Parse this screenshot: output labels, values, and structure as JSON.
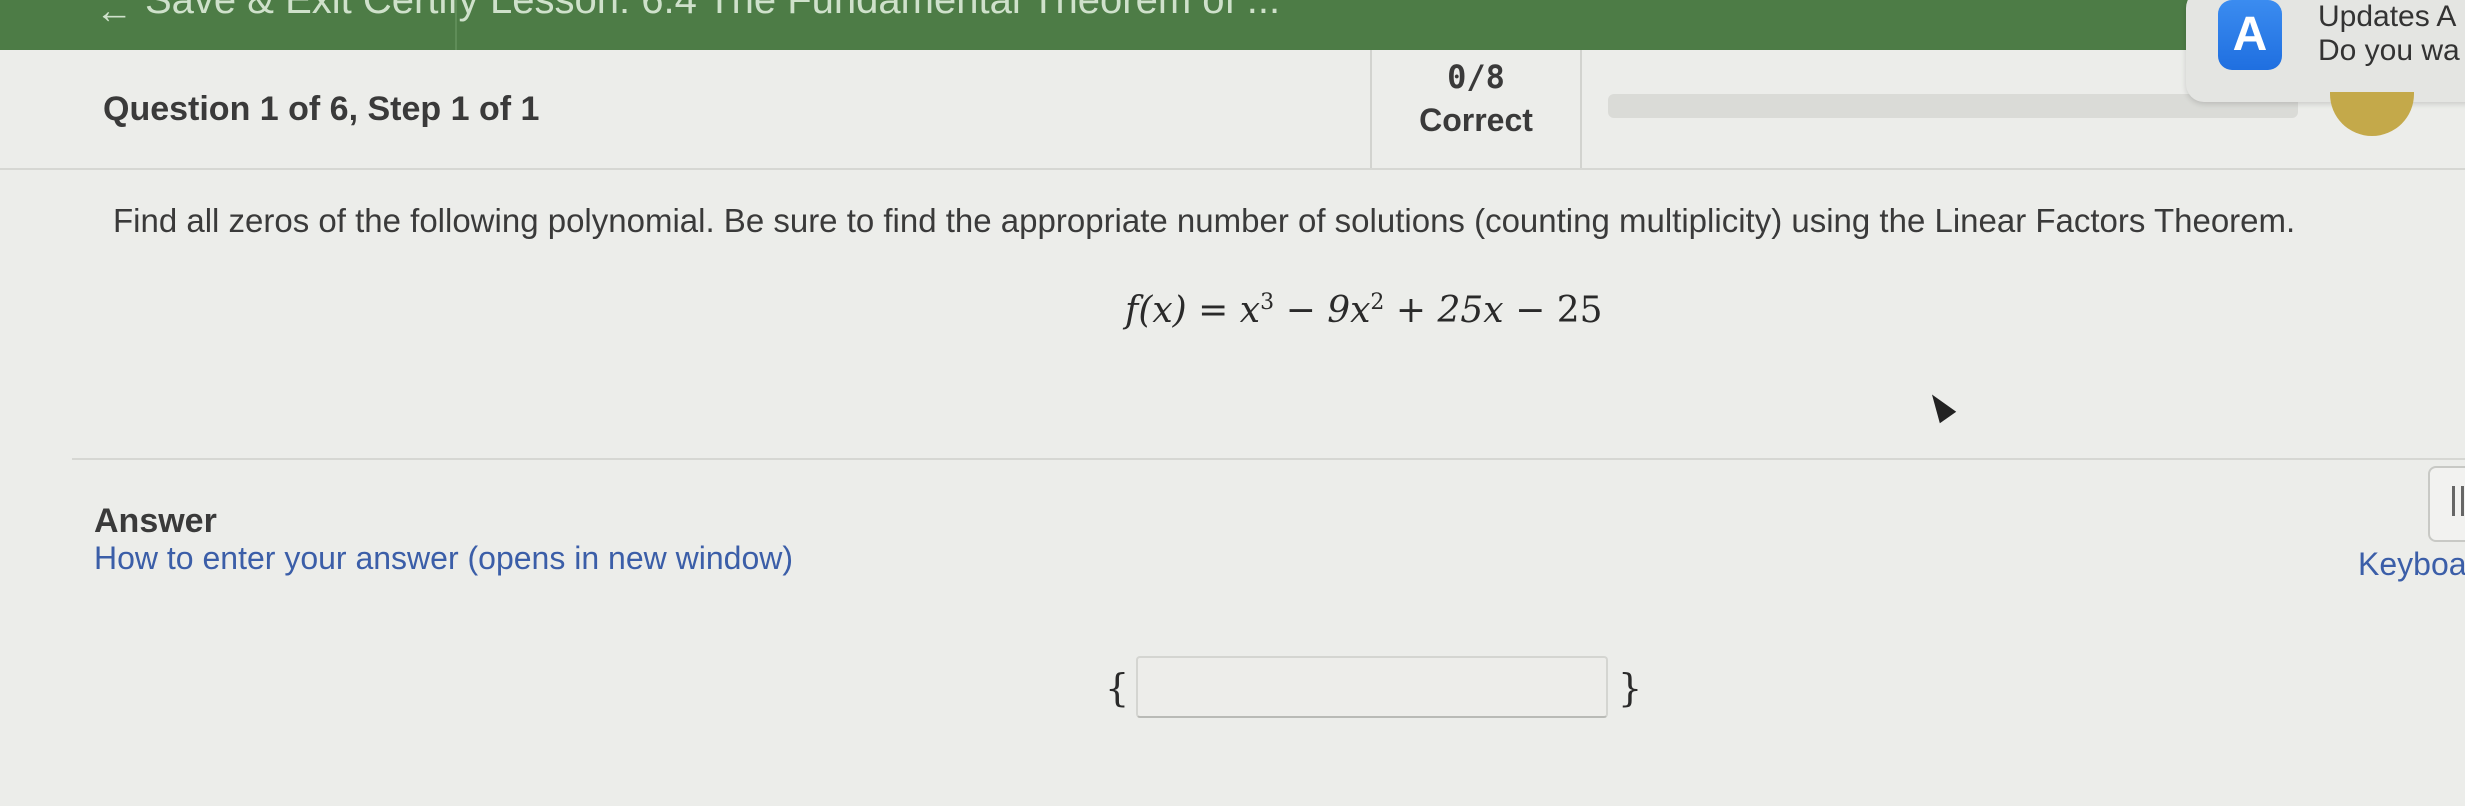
{
  "topbar": {
    "left_crumb": "Save & Exit Certify",
    "mid_crumb": "Lesson: 6.4 The Fundamental Theorem of ...",
    "accent": "#4d7c46"
  },
  "question": {
    "title": "Question 1 of 6, Step 1 of 1",
    "score": "0/8",
    "score_label": "Correct",
    "progress": 0,
    "prompt": "Find all zeros of the following polynomial. Be sure to find the appropriate number of solutions (counting multiplicity) using the Linear Factors Theorem."
  },
  "formula": {
    "lhs": "f(x)",
    "eq": "=",
    "t1_base": "x",
    "t1_exp": "3",
    "op1": "−",
    "t2_coef": "9x",
    "t2_exp": "2",
    "op2": "+",
    "t3": "25x",
    "op3": "−",
    "t4": "25"
  },
  "answer": {
    "label": "Answer",
    "howto_link": "How to enter your answer (opens in new window)",
    "keyboard_link": "Keyboa",
    "open_brace": "{",
    "close_brace": "}",
    "input_value": ""
  },
  "notification": {
    "icon": "app-store-icon",
    "title": "Updates A",
    "body": "Do you wa"
  }
}
